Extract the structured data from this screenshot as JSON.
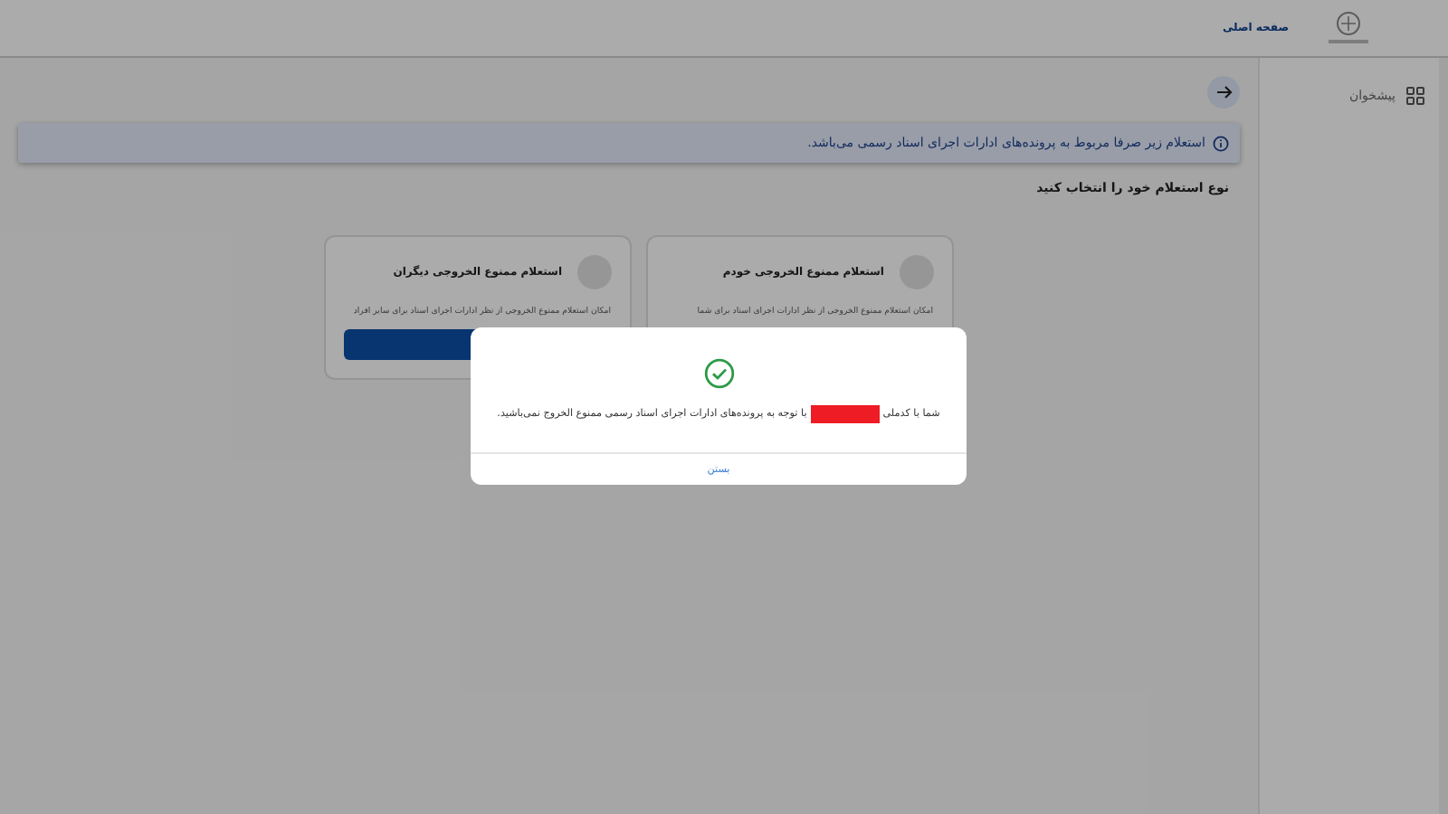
{
  "header": {
    "home_link": "صفحه اصلی"
  },
  "sidebar": {
    "items": [
      {
        "label": "پیشخوان",
        "selected": false
      }
    ]
  },
  "main": {
    "notice": "استعلام زیر صرفا مربوط به پرونده‌های ادارات اجرای اسناد رسمی می‌باشد.",
    "prompt": "نوع استعلام خود را انتخاب کنید",
    "cards": [
      {
        "title": "استعلام ممنوع الخروجی خودم",
        "description": "امکان استعلام ممنوع الخروجی از نظر ادارات اجرای اسناد برای شما"
      },
      {
        "title": "استعلام ممنوع الخروجی دیگران",
        "description": "امکان استعلام ممنوع الخروجی از نظر ادارات اجرای اسناد برای سایر افراد",
        "has_button": true
      }
    ]
  },
  "dialog": {
    "message_start": "شما با کدملی",
    "message_end": "با توجه به پرونده‌های ادارات اجرای اسناد رسمی ممنوع الخروج نمی‌باشید.",
    "close": "بستن"
  }
}
